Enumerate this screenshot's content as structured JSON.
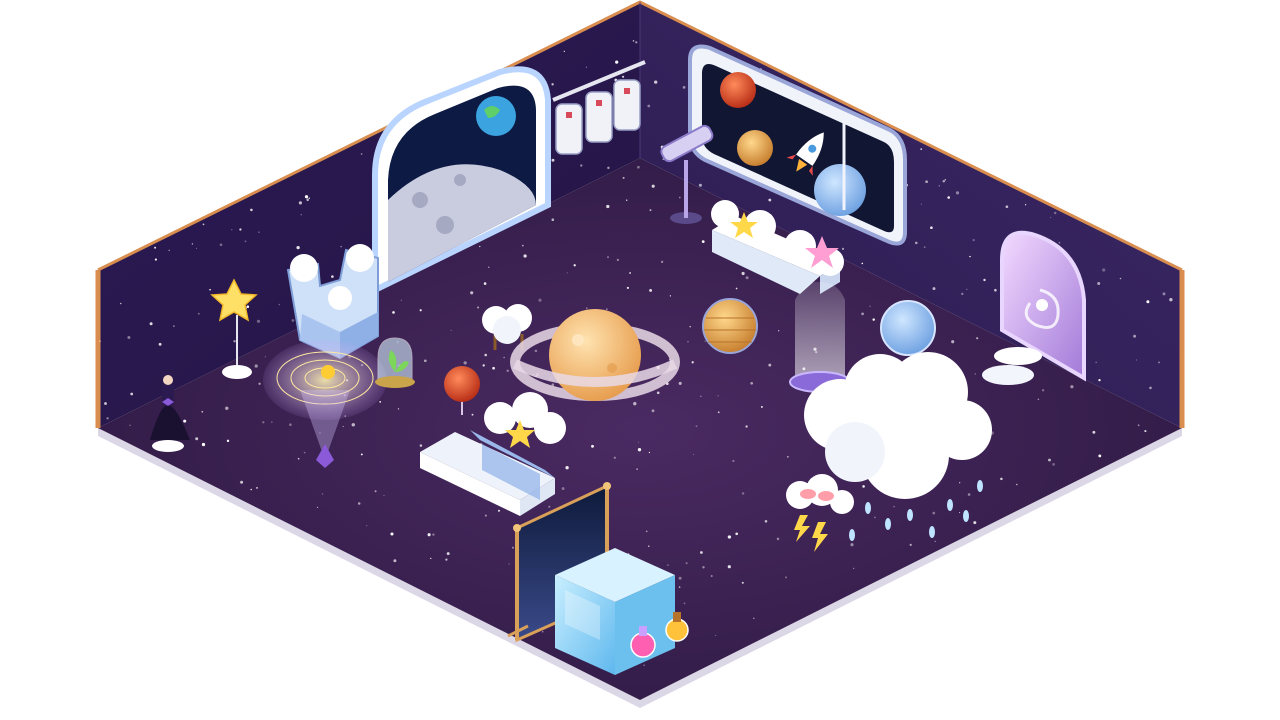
{
  "scene": {
    "type": "isometric-room",
    "theme": "outer-space bedroom",
    "colors": {
      "background": "#ffffff",
      "wall_left": "#2a1a4f",
      "wall_right": "#35235c",
      "floor": "#3a2350",
      "floor_edge": "#e4e0ee",
      "wall_trim": "#d98e4f",
      "star": "#ffffff",
      "accent_star": "#ffd84a",
      "accent_pink": "#ff9ed2",
      "cloud": "#ffffff",
      "ice": "#8fd3ff"
    },
    "objects": [
      {
        "id": "moon-window",
        "icon": "moon-window-icon"
      },
      {
        "id": "spacesuit-rack",
        "icon": "spacesuit-icon"
      },
      {
        "id": "planet-window",
        "icon": "rocket-window-icon"
      },
      {
        "id": "telescope",
        "icon": "telescope-icon"
      },
      {
        "id": "cloud-sofa",
        "icon": "sofa-icon"
      },
      {
        "id": "galaxy-portal",
        "icon": "galaxy-portal-icon"
      },
      {
        "id": "star-lamp",
        "icon": "star-lamp-icon"
      },
      {
        "id": "ice-armchair",
        "icon": "armchair-icon"
      },
      {
        "id": "solar-hologram",
        "icon": "hologram-icon"
      },
      {
        "id": "plant-jar",
        "icon": "plant-jar-icon"
      },
      {
        "id": "dress-mannequin",
        "icon": "mannequin-icon"
      },
      {
        "id": "cloud-stool",
        "icon": "stool-icon"
      },
      {
        "id": "saturn-rug",
        "icon": "saturn-icon"
      },
      {
        "id": "jupiter-orb",
        "icon": "planet-icon"
      },
      {
        "id": "mars-orb",
        "icon": "planet-icon"
      },
      {
        "id": "neptune-orb",
        "icon": "planet-icon"
      },
      {
        "id": "light-beam",
        "icon": "beam-icon"
      },
      {
        "id": "cloud-bed",
        "icon": "bed-icon"
      },
      {
        "id": "rain-cloud",
        "icon": "cloud-icon"
      },
      {
        "id": "slippers-cloud",
        "icon": "slippers-icon"
      },
      {
        "id": "night-divider",
        "icon": "divider-icon"
      },
      {
        "id": "ice-cube",
        "icon": "ice-cube-icon"
      },
      {
        "id": "potions",
        "icon": "potion-icon"
      },
      {
        "id": "cloud-steps",
        "icon": "steps-icon"
      }
    ]
  }
}
